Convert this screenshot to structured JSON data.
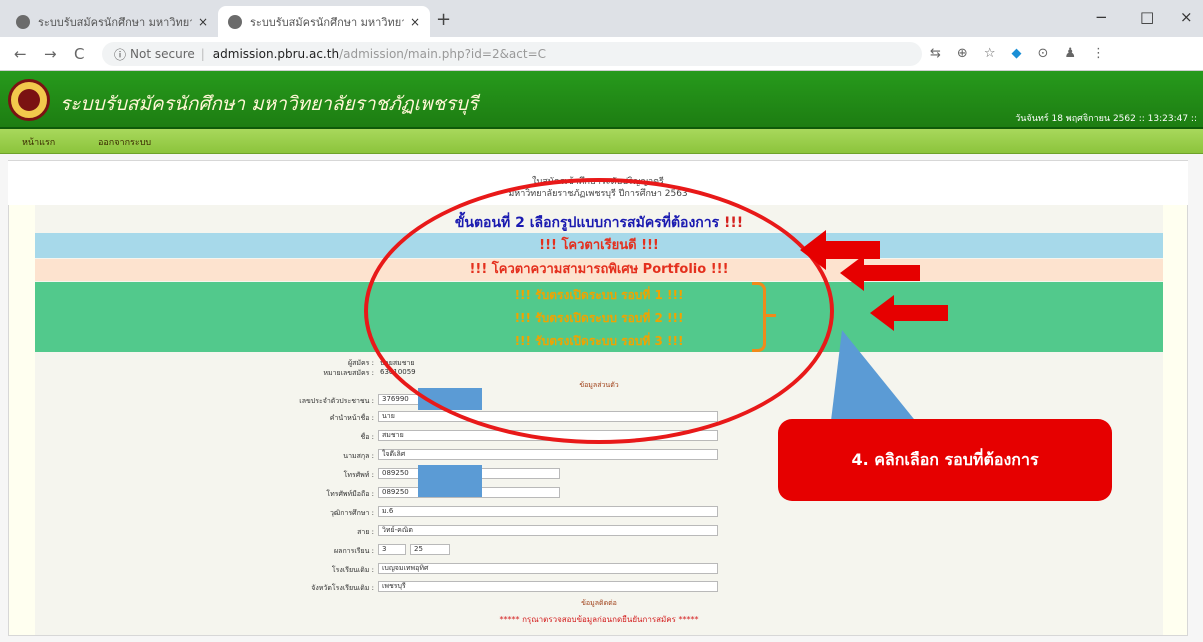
{
  "browser": {
    "tabs": [
      {
        "title": "ระบบรับสมัครนักศึกษา มหาวิทยาลัย...",
        "close": "×"
      },
      {
        "title": "ระบบรับสมัครนักศึกษา มหาวิทยาลัย...",
        "close": "×"
      }
    ],
    "new_tab": "+",
    "window_controls": {
      "minimize": "−",
      "maximize": "□",
      "close": "×"
    },
    "nav": {
      "back": "←",
      "forward": "→",
      "reload": "C"
    },
    "omnibox": {
      "security_icon": "ⓘ",
      "security_label": "Not secure",
      "host": "admission.pbru.ac.th",
      "path": "/admission/main.php?id=2&act=C"
    }
  },
  "site": {
    "title": "ระบบรับสมัครนักศึกษา มหาวิทยาลัยราชภัฏเพชรบุรี",
    "date": "วันจันทร์ 18 พฤศจิกายน 2562 :: 13:23:47 ::",
    "menu": [
      "หน้าแรก",
      "ออกจากระบบ"
    ]
  },
  "page": {
    "intro_line1": "ใบสมัครเข้าศึกษาระดับปริญญาตรี",
    "intro_line2": "มหาวิทยาลัยราชภัฏเพชรบุรี ปีการศึกษา 2563",
    "step_text": "ขั้นตอนที่ 2 เลือกรูปแบบการสมัครที่ต้องการ",
    "step_marks": "!!!",
    "quota_label": "!!! โควตาเรียนดี !!!",
    "portfolio_label": "!!! โควตาความสามารถพิเศษ Portfolio !!!",
    "rounds": [
      "!!! รับตรงเปิดระบบ รอบที่ 1 !!!",
      "!!! รับตรงเปิดระบบ รอบที่ 2 !!!",
      "!!! รับตรงเปิดระบบ รอบที่ 3 !!!"
    ]
  },
  "form": {
    "applicant_label": "ผู้สมัคร :",
    "applicant_value": "นายสมชาย",
    "app_no_label": "หมายเลขสมัคร :",
    "app_no_value": "63010059",
    "section_personal": "ข้อมูลส่วนตัว",
    "section_address": "ข้อมูลติดต่อ",
    "fields": [
      {
        "label": "เลขประจำตัวประชาชน :",
        "value": "376990"
      },
      {
        "label": "คำนำหน้าชื่อ :",
        "value": "นาย"
      },
      {
        "label": "ชื่อ :",
        "value": "สมชาย"
      },
      {
        "label": "นามสกุล :",
        "value": "ใจดีเลิศ"
      },
      {
        "label": "โทรศัพท์ :",
        "value": "089250"
      },
      {
        "label": "โทรศัพท์มือถือ :",
        "value": "089250"
      },
      {
        "label": "วุฒิการศึกษา :",
        "value": "ม.6"
      },
      {
        "label": "สาย :",
        "value": "วิทย์-คณิต"
      },
      {
        "label": "ผลการเรียน :",
        "value": "3",
        "value2": "25"
      },
      {
        "label": "โรงเรียนเดิม :",
        "value": "เบญจมเทพอุทิศ"
      },
      {
        "label": "จังหวัดโรงเรียนเดิม :",
        "value": "เพชรบุรี"
      }
    ],
    "footnote": "***** กรุณาตรวจสอบข้อมูลก่อนกดยืนยันการสมัคร *****"
  },
  "annotation": {
    "callout_text": "4. คลิกเลือก รอบที่ต้องการ",
    "color": "#e60000"
  }
}
